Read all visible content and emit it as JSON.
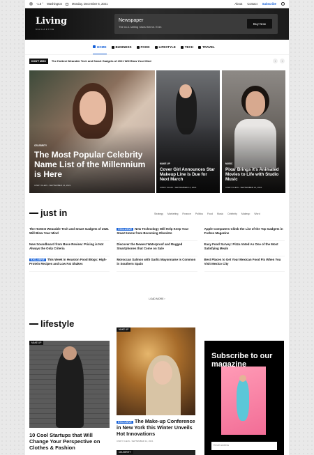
{
  "topbar": {
    "weather": "-1.6 °",
    "location": "Washington",
    "date": "Monday, December 6, 2021",
    "links": [
      "About",
      "Contact"
    ],
    "subscribe": "Subscribe"
  },
  "header": {
    "logo": "Living",
    "logo_sub": "MAGAZINE",
    "ad_title": "Newspaper",
    "ad_sub": "The no.1 selling news theme. Ever.",
    "ad_button": "Buy Now"
  },
  "nav": [
    {
      "label": "HOME",
      "active": true,
      "icon": "home-icon"
    },
    {
      "label": "BUSINESS",
      "icon": "briefcase-icon"
    },
    {
      "label": "FOOD",
      "icon": "utensils-icon"
    },
    {
      "label": "LIFESTYLE",
      "icon": "heart-icon"
    },
    {
      "label": "TECH",
      "icon": "camera-icon"
    },
    {
      "label": "TRAVEL",
      "icon": "plane-icon"
    }
  ],
  "ticker": {
    "badge": "DON'T MISS",
    "text": "The Hottest Wearable Tech and Smart Gadgets of 2021 Will Blow Your Mind"
  },
  "hero": {
    "main": {
      "category": "CELEBRITY",
      "title": "The Most Popular Celebrity Name List of the Millennium is Here",
      "author": "CINDY KLEIN",
      "date": "SEPTEMBER 14, 2021"
    },
    "second": {
      "category": "MAKE UP",
      "title": "Cover Girl Announces Star Makeup Line is Due for Next March",
      "author": "CINDY KLEIN",
      "date": "SEPTEMBER 14, 2021"
    },
    "third": {
      "category": "MUSIC",
      "title": "Pixar Brings it's Animated Movies to Life with Studio Music",
      "author": "CINDY KLEIN",
      "date": "SEPTEMBER 14, 2021"
    }
  },
  "just_in": {
    "heading": "just in",
    "filters": [
      "Strategy",
      "Marketing",
      "Finance",
      "Politics",
      "Food",
      "Music",
      "Celebrity",
      "Makeup",
      "Word"
    ],
    "items": [
      {
        "badge": "",
        "text": "The Hottest Wearable Tech and Smart Gadgets of 2021 Will Blow Your Mind"
      },
      {
        "badge": "EXCLUSIVE",
        "text": "New Technology Will Help Keep Your Smart Home from Becoming Obsolete"
      },
      {
        "badge": "",
        "text": "Apple Computers Climb the List of the Top Gadgets in Forbes Magazine"
      },
      {
        "badge": "",
        "text": "New Soundboard from Bose Review: Pricing is Not Always the Only Criteria"
      },
      {
        "badge": "",
        "text": "Discover the Newest Waterproof and Rugged Smartphones that Come on Sale"
      },
      {
        "badge": "",
        "text": "Easy Food Survey: Pizza Voted As One of the Most Satisfying Meals"
      },
      {
        "badge": "EXCLUSIVE",
        "text": "This Week in Houston Food Blogs: High-Protein Recipes and Low Fat Shakes"
      },
      {
        "badge": "",
        "text": "Moroccan Salmon with Garlic Mayonnaise is Common in Southern Spain"
      },
      {
        "badge": "",
        "text": "Best Places to Get Your Mexican Food Fix When You Visit Mexico City"
      }
    ],
    "load_more": "LOAD MORE ›"
  },
  "lifestyle": {
    "heading": "lifestyle",
    "left": {
      "category": "MAKE UP",
      "title": "10 Cool Startups that Will Change Your Perspective on Clothes & Fashion"
    },
    "middle": {
      "category": "MAKE UP",
      "badge": "EXCLUSIVE",
      "title": "The Make-up Conference in New York this Winter Unveils Hot Innovations",
      "author": "CINDY KLEIN",
      "date": "SEPTEMBER 14, 2021"
    },
    "bottom_category": "CELEBRITY",
    "subscribe_title": "Subscribe to our magazine",
    "email_placeholder": "Email address"
  },
  "colors": {
    "accent": "#1560d8"
  }
}
